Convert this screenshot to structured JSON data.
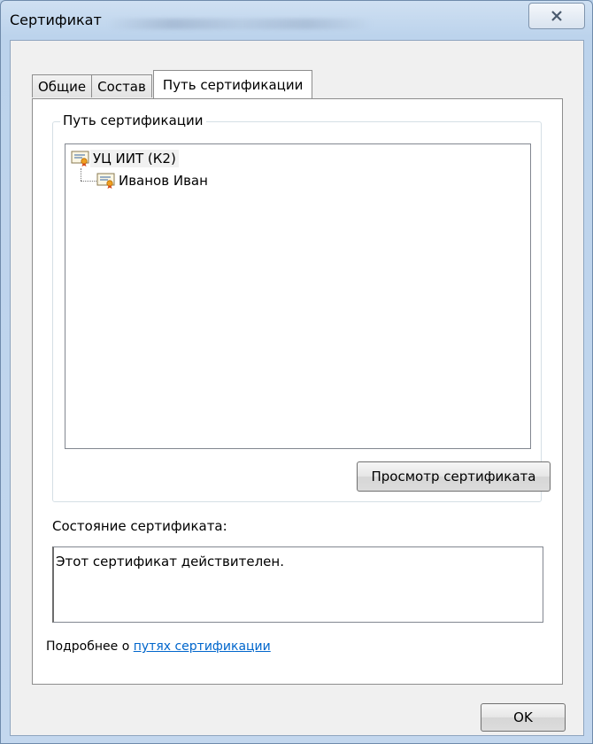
{
  "window": {
    "title": "Сертификат"
  },
  "tabs": [
    {
      "label": "Общие"
    },
    {
      "label": "Состав"
    },
    {
      "label": "Путь сертификации"
    }
  ],
  "path_group": {
    "legend": "Путь сертификации",
    "tree": [
      {
        "label": "УЦ ИИТ (К2)",
        "level": 0,
        "icon": "certificate-icon"
      },
      {
        "label": "Иванов Иван",
        "level": 1,
        "icon": "certificate-icon"
      }
    ],
    "view_button": "Просмотр сертификата"
  },
  "status": {
    "label": "Состояние сертификата:",
    "text": "Этот сертификат действителен."
  },
  "more_info": {
    "prefix": "Подробнее о ",
    "link": "путях сертификации"
  },
  "buttons": {
    "ok": "OK"
  },
  "colors": {
    "link": "#0066cc",
    "window_frame": "#c3d7ee",
    "client_bg": "#f0f0f0"
  }
}
